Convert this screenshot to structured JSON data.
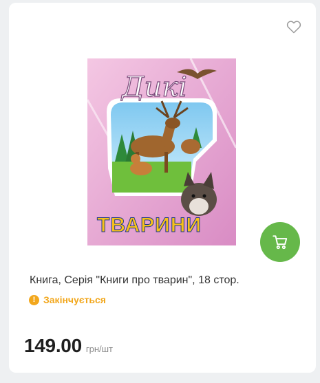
{
  "product": {
    "title": "Книга, Серія \"Книги про тварин\", 18 стор.",
    "stock_status": "Закінчується",
    "price": "149.00",
    "price_unit": "грн/шт",
    "cover": {
      "title_top": "Дикі",
      "title_bottom": "ТВАРИНИ",
      "bottom_letter_colors": [
        "#2b3fc4",
        "#e8222a",
        "#2b9a3a",
        "#f7c11a",
        "#8a2bd6",
        "#e8222a",
        "#1e9ad6"
      ]
    }
  },
  "colors": {
    "accent_green": "#66b84a",
    "warning_orange": "#f2a71c"
  },
  "icons": {
    "wishlist": "heart-outline-icon",
    "cart": "cart-icon",
    "stock": "exclamation-icon"
  }
}
